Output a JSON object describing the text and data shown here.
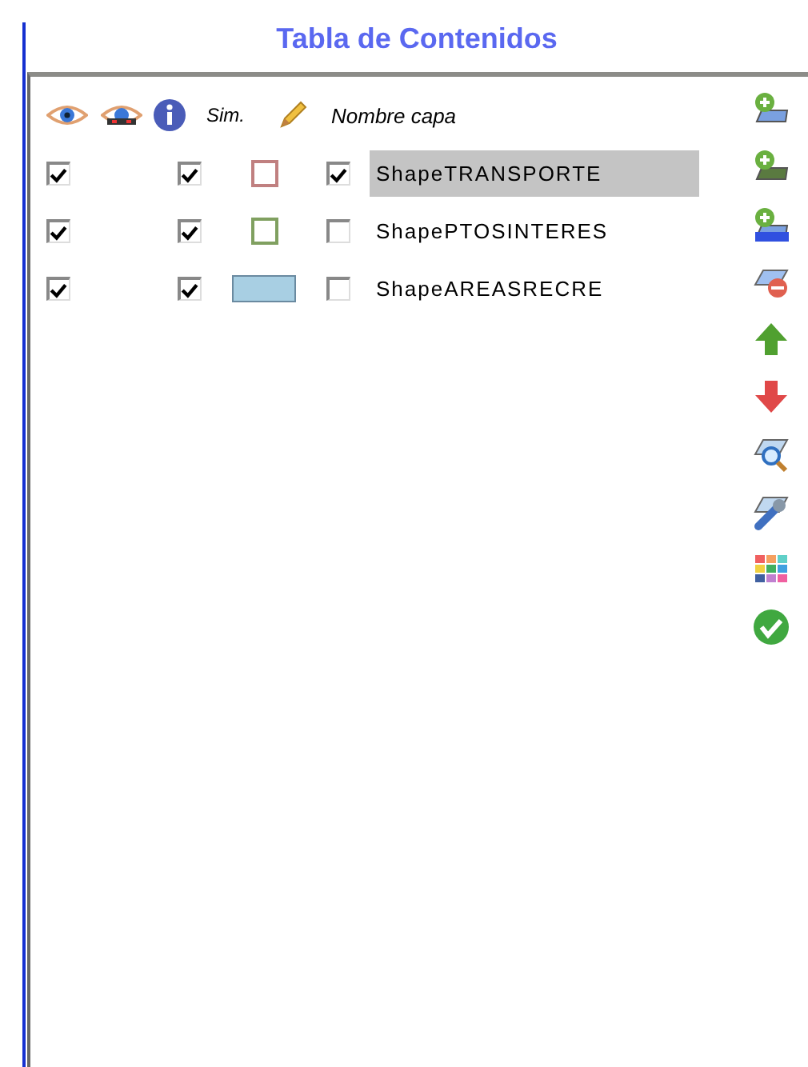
{
  "title": "Tabla de Contenidos",
  "header": {
    "symbol_label": "Sim.",
    "name_label": "Nombre capa"
  },
  "layers": [
    {
      "name": "ShapeTRANSPORTE",
      "visible": true,
      "active": true,
      "kind": "outline",
      "color": "#c08080",
      "editable": true,
      "selected": true
    },
    {
      "name": "ShapePTOSINTERES",
      "visible": true,
      "active": true,
      "kind": "outline",
      "color": "#80a060",
      "editable": false,
      "selected": false
    },
    {
      "name": "ShapeAREASRECRE",
      "visible": true,
      "active": true,
      "kind": "fill",
      "color": "#a8cfe3",
      "editable": false,
      "selected": false
    }
  ],
  "tools": [
    {
      "kind": "add-layer"
    },
    {
      "kind": "add-raster"
    },
    {
      "kind": "add-wms"
    },
    {
      "kind": "remove"
    },
    {
      "kind": "up"
    },
    {
      "kind": "down"
    },
    {
      "kind": "zoom"
    },
    {
      "kind": "properties"
    },
    {
      "kind": "palette"
    },
    {
      "kind": "ok"
    }
  ]
}
